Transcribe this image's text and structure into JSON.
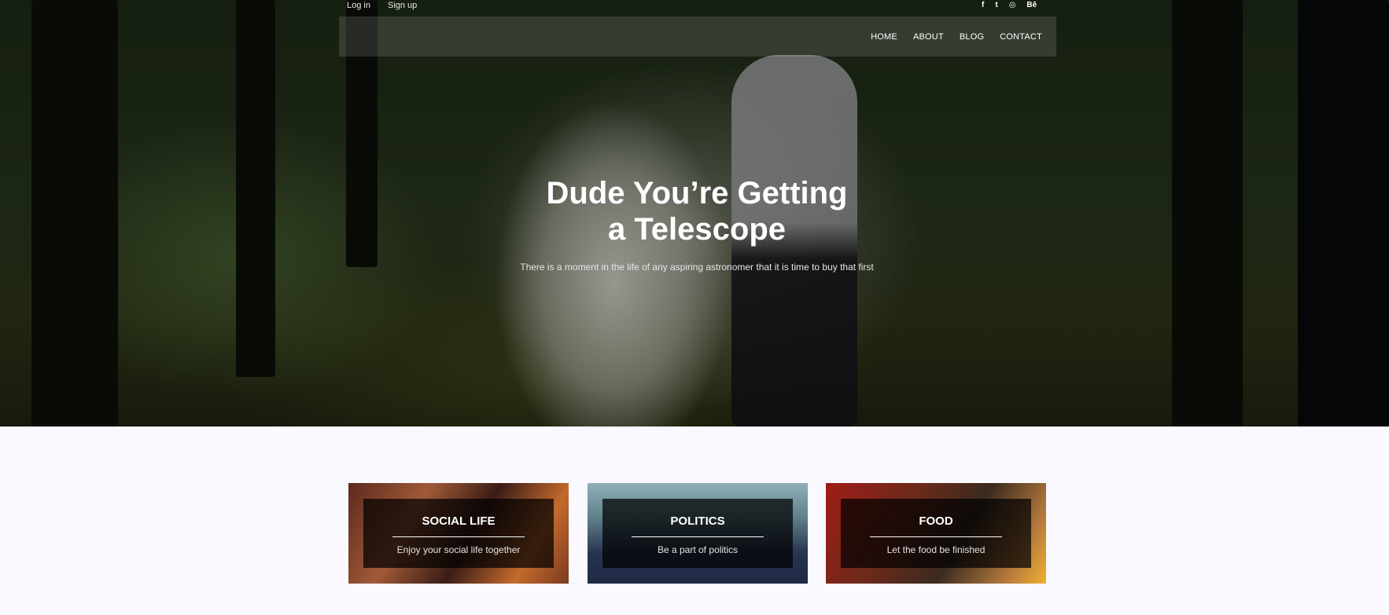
{
  "topbar": {
    "login_label": "Log in",
    "signup_label": "Sign up",
    "social": [
      {
        "icon": "facebook-icon",
        "glyph": "f"
      },
      {
        "icon": "twitter-icon",
        "glyph": "t"
      },
      {
        "icon": "dribbble-icon",
        "glyph": "◎"
      },
      {
        "icon": "behance-icon",
        "glyph": "Bē"
      }
    ]
  },
  "nav": {
    "items": [
      "HOME",
      "ABOUT",
      "BLOG",
      "CONTACT"
    ]
  },
  "hero": {
    "title_line1": "Dude You’re Getting",
    "title_line2": "a Telescope",
    "subtitle": "There is a moment in the life of any aspiring astronomer that it is time to buy that first"
  },
  "cards": [
    {
      "title": "SOCIAL LIFE",
      "description": "Enjoy your social life together"
    },
    {
      "title": "POLITICS",
      "description": "Be a part of politics"
    },
    {
      "title": "FOOD",
      "description": "Let the food be finished"
    }
  ],
  "colors": {
    "page_background": "#f9f9ff",
    "card_box": "#000000",
    "text_light": "#ffffff"
  }
}
